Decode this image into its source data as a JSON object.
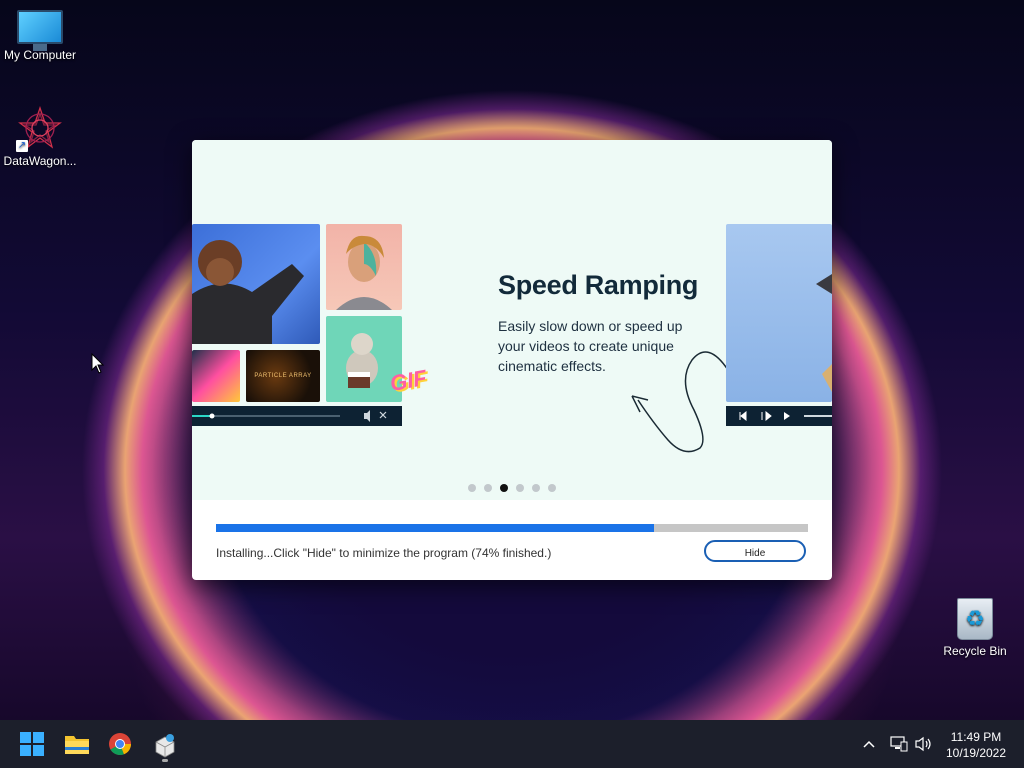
{
  "desktop": {
    "icons": [
      {
        "label": "My Computer",
        "icon": "computer-icon"
      },
      {
        "label": "DataWagon...",
        "icon": "datawagon-icon"
      },
      {
        "label": "Recycle Bin",
        "icon": "recycle-bin-icon"
      }
    ]
  },
  "installer": {
    "slide": {
      "title": "Speed Ramping",
      "description": "Easily slow down or speed up your videos to create unique cinematic effects.",
      "card_text": "PARTICLE ARRAY",
      "sticker_text": "GIF"
    },
    "carousel": {
      "count": 6,
      "active_index": 2
    },
    "progress_fraction": 0.74,
    "status_text": "Installing...Click \"Hide\" to minimize the program (74% finished.)",
    "hide_label": "Hide",
    "accent_color": "#1a73e8"
  },
  "taskbar": {
    "apps": [
      "start-icon",
      "file-explorer-icon",
      "chrome-icon",
      "installer-app-icon"
    ],
    "tray": [
      "chevron-up-icon",
      "network-icon",
      "volume-icon"
    ],
    "time": "11:49 PM",
    "date": "10/19/2022"
  }
}
